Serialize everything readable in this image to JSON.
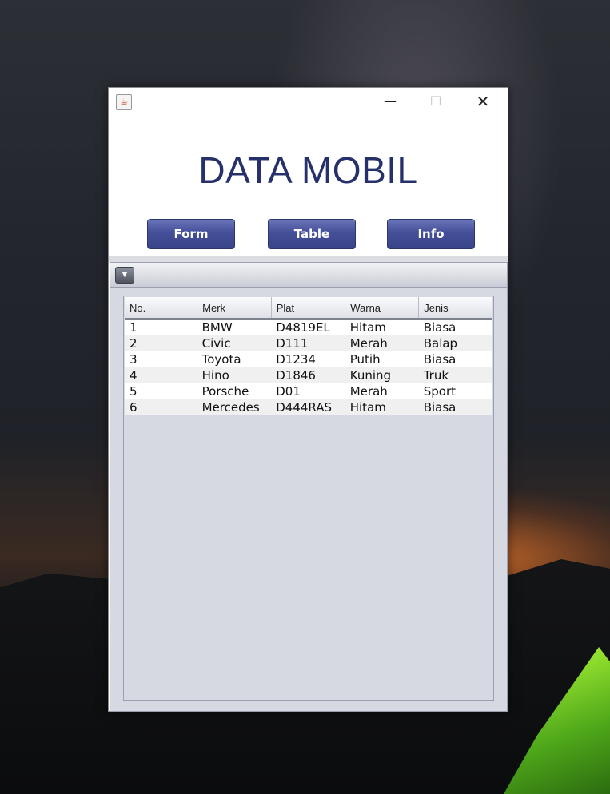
{
  "window": {
    "icon": "java-cup-icon",
    "controls": {
      "minimize": "—",
      "maximize": "☐",
      "close": "✕"
    }
  },
  "header": {
    "title": "DATA MOBIL",
    "buttons": {
      "form": "Form",
      "table": "Table",
      "info": "Info"
    }
  },
  "frame_menu_icon": "▼",
  "table": {
    "columns": [
      "No.",
      "Merk",
      "Plat",
      "Warna",
      "Jenis"
    ],
    "rows": [
      [
        "1",
        "BMW",
        "D4819EL",
        "Hitam",
        "Biasa"
      ],
      [
        "2",
        "Civic",
        "D111",
        "Merah",
        "Balap"
      ],
      [
        "3",
        "Toyota",
        "D1234",
        "Putih",
        "Biasa"
      ],
      [
        "4",
        "Hino",
        "D1846",
        "Kuning",
        "Truk"
      ],
      [
        "5",
        "Porsche",
        "D01",
        "Merah",
        "Sport"
      ],
      [
        "6",
        "Mercedes",
        "D444RAS",
        "Hitam",
        "Biasa"
      ]
    ]
  },
  "colors": {
    "title": "#26306b",
    "button": "#444f99",
    "frame_bg": "#d6d9e1"
  }
}
